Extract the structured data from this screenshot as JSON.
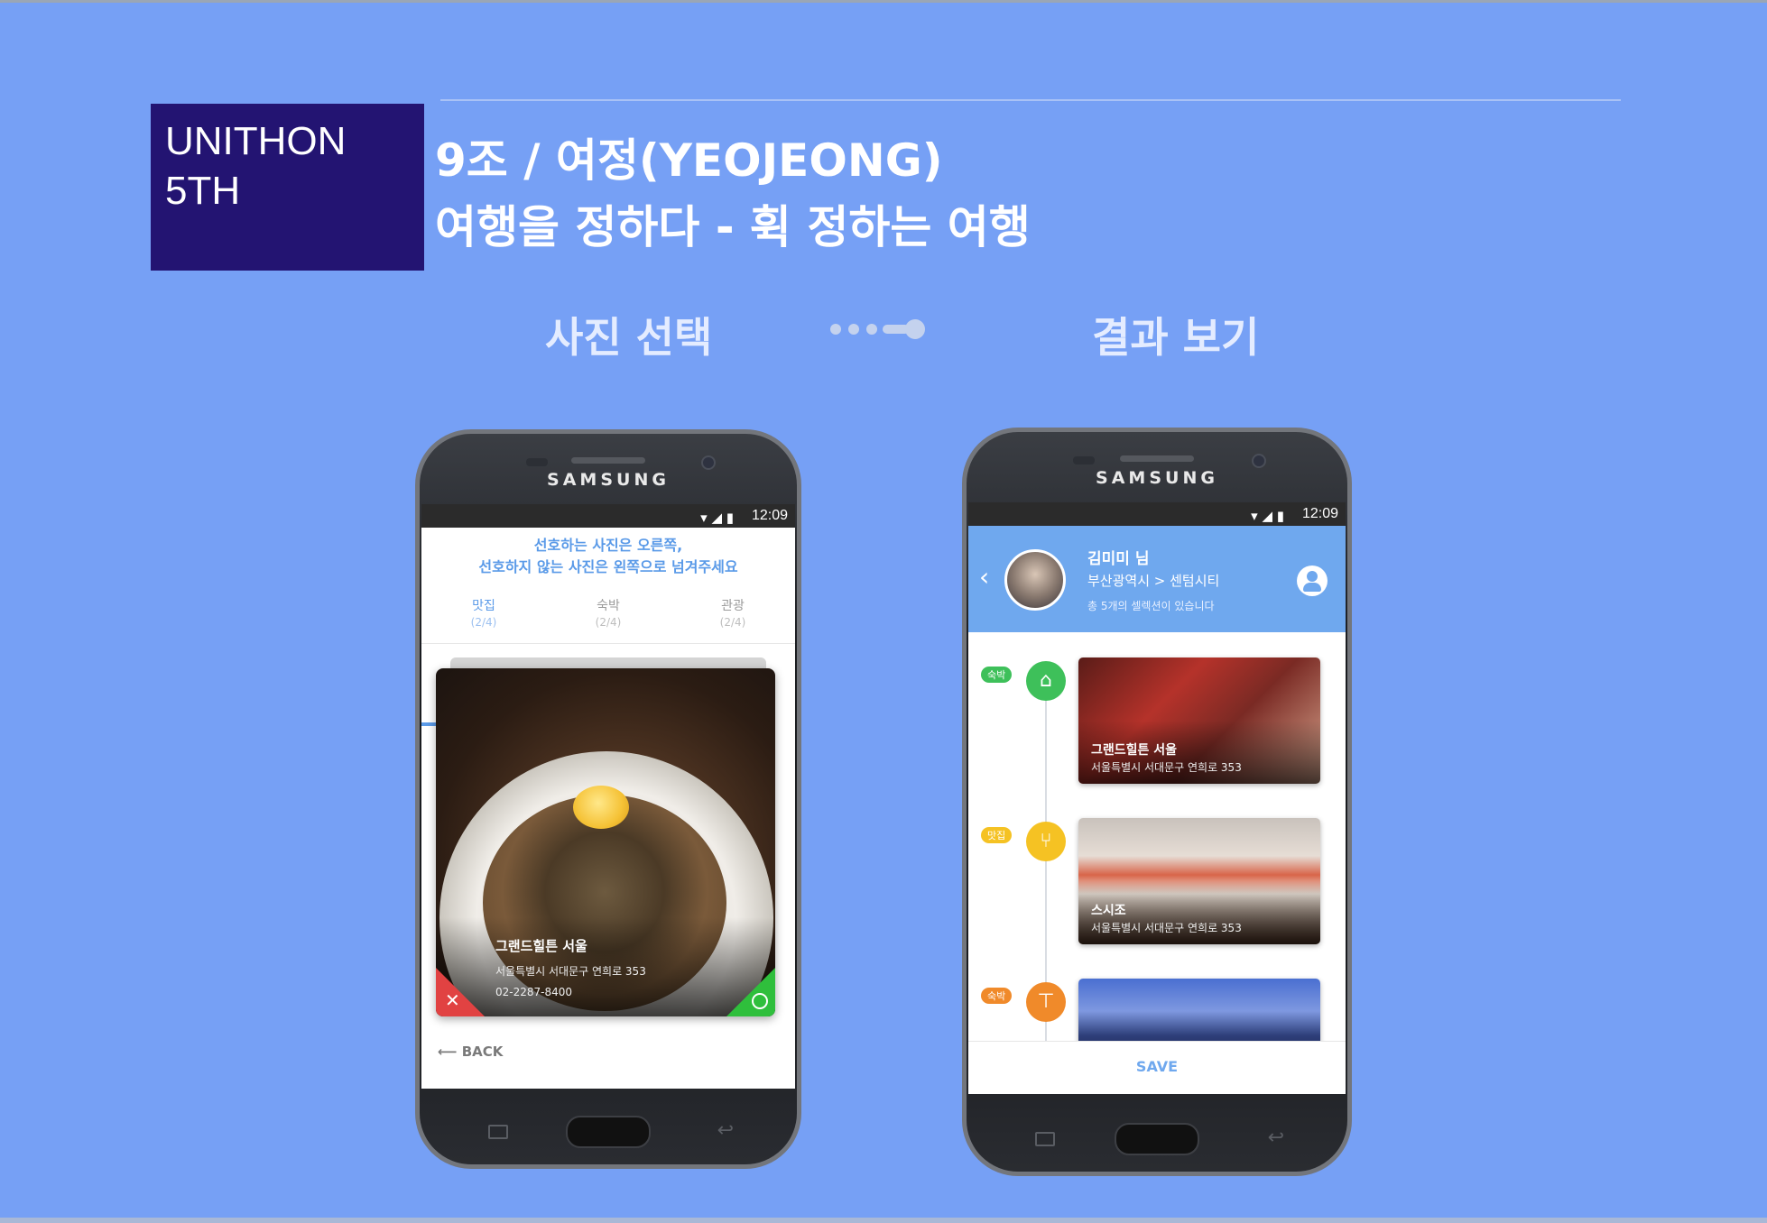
{
  "brand": {
    "line1": "UNITHON",
    "line2": "5TH"
  },
  "title": {
    "line1": "9조 / 여정(YEOJEONG)",
    "line2": "여행을 정하다 - 휙 정하는 여행"
  },
  "flow": {
    "left_label": "사진 선택",
    "right_label": "결과 보기",
    "arrow_icon": "dotted-arrow-icon"
  },
  "colors": {
    "background": "#76a0f5",
    "brand_box": "#231472",
    "accent_blue": "#5a9ae8",
    "green": "#3ec05a",
    "yellow": "#f5c223",
    "orange": "#f08a2a",
    "reject": "#e14242"
  },
  "phone_left": {
    "brand": "SAMSUNG",
    "status_time": "12:09",
    "instructions": [
      "선호하는 사진은 오른쪽,",
      "선호하지 않는 사진은 왼쪽으로 넘겨주세요"
    ],
    "tabs": [
      {
        "label": "맛집",
        "count": "(2/4)",
        "active": true
      },
      {
        "label": "숙박",
        "count": "(2/4)",
        "active": false
      },
      {
        "label": "관광",
        "count": "(2/4)",
        "active": false
      }
    ],
    "card": {
      "title": "그랜드힐튼 서울",
      "address": "서울특별시 서대문구 연희로 353",
      "phone": "02-2287-8400",
      "reject_icon": "x-icon",
      "accept_icon": "circle-icon"
    },
    "back_label": "BACK"
  },
  "phone_right": {
    "brand": "SAMSUNG",
    "status_time": "12:09",
    "profile": {
      "name": "김미미 님",
      "location": "부산광역시 > 센텀시티",
      "count_text": "총 5개의 셀렉션이 있습니다"
    },
    "timeline": [
      {
        "badge": "숙박",
        "icon": "home-icon",
        "title": "그랜드힐튼 서울",
        "address": "서울특별시 서대문구 연희로 353"
      },
      {
        "badge": "맛집",
        "icon": "utensils-icon",
        "title": "스시조",
        "address": "서울특별시 서대문구 연희로 353"
      },
      {
        "badge": "숙박",
        "icon": "signpost-icon",
        "title": "",
        "address": ""
      }
    ],
    "save_label": "SAVE"
  }
}
